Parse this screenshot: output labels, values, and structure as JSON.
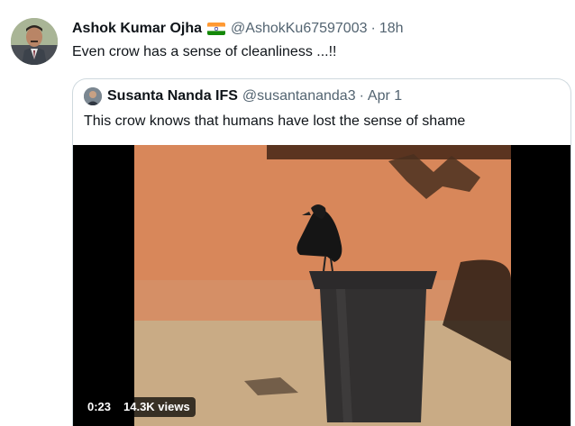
{
  "tweet": {
    "author_name": "Ashok Kumar Ojha",
    "author_handle": "@AshokKu67597003",
    "separator": "·",
    "time": "18h",
    "text": "Even crow has a sense of cleanliness ...!!",
    "flag_icon": "india-flag-emoji"
  },
  "quoted_tweet": {
    "author_name": "Susanta Nanda IFS",
    "author_handle": "@susantananda3",
    "separator": "·",
    "time": "Apr 1",
    "text": "This crow knows that humans have lost the sense of shame",
    "video": {
      "duration": "0:23",
      "views": "14.3K views"
    }
  },
  "colors": {
    "text_primary": "#0f1419",
    "text_secondary": "#536471",
    "border": "#cfd9de",
    "wall": "#d8875a",
    "ground": "#c9ab85"
  }
}
